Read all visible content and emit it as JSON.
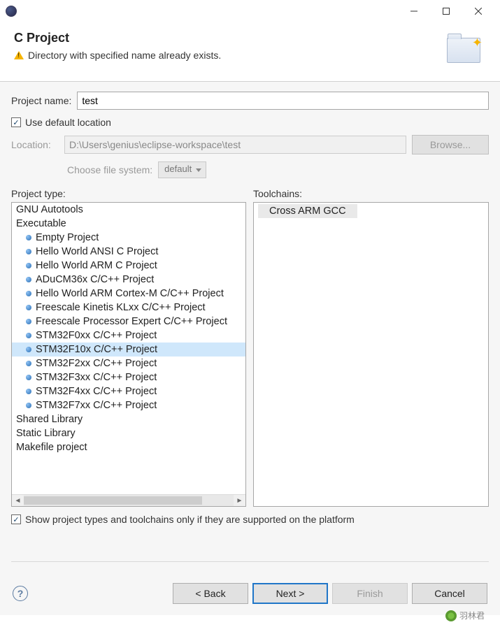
{
  "header": {
    "title": "C Project",
    "warning": "Directory with specified name already exists."
  },
  "form": {
    "project_name_label": "Project name:",
    "project_name_value": "test",
    "use_default_location_label": "Use default location",
    "location_label": "Location:",
    "location_value": "D:\\Users\\genius\\eclipse-workspace\\test",
    "browse_label": "Browse...",
    "choose_fs_label": "Choose file system:",
    "fs_value": "default"
  },
  "project_type": {
    "label": "Project type:",
    "items": [
      {
        "label": "GNU Autotools",
        "group": true
      },
      {
        "label": "Executable",
        "group": true
      },
      {
        "label": "Empty Project"
      },
      {
        "label": "Hello World ANSI C Project"
      },
      {
        "label": "Hello World ARM C Project"
      },
      {
        "label": "ADuCM36x C/C++ Project"
      },
      {
        "label": "Hello World ARM Cortex-M C/C++ Project"
      },
      {
        "label": "Freescale Kinetis KLxx C/C++ Project"
      },
      {
        "label": "Freescale Processor Expert C/C++ Project"
      },
      {
        "label": "STM32F0xx C/C++ Project"
      },
      {
        "label": "STM32F10x C/C++ Project",
        "selected": true
      },
      {
        "label": "STM32F2xx C/C++ Project"
      },
      {
        "label": "STM32F3xx C/C++ Project"
      },
      {
        "label": "STM32F4xx C/C++ Project"
      },
      {
        "label": "STM32F7xx C/C++ Project"
      },
      {
        "label": "Shared Library",
        "group": true
      },
      {
        "label": "Static Library",
        "group": true
      },
      {
        "label": "Makefile project",
        "group": true
      }
    ]
  },
  "toolchains": {
    "label": "Toolchains:",
    "items": [
      {
        "label": "Cross ARM GCC",
        "selected": true
      }
    ]
  },
  "show_supported_label": "Show project types and toolchains only if they are supported on the platform",
  "buttons": {
    "back": "< Back",
    "next": "Next >",
    "finish": "Finish",
    "cancel": "Cancel"
  },
  "watermark": "羽林君"
}
